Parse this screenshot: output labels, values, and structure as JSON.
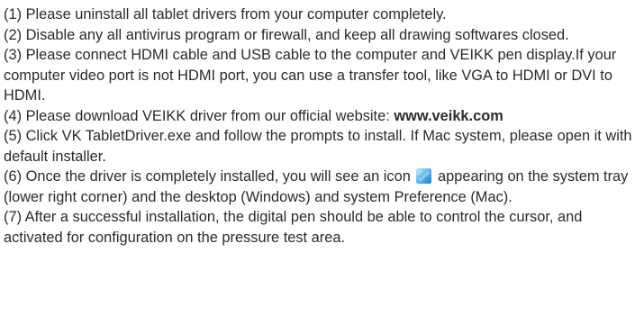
{
  "steps": [
    {
      "text": "(1) Please uninstall all tablet drivers from your computer completely."
    },
    {
      "text": "(2) Disable any all antivirus program or firewall, and keep all drawing softwares closed."
    },
    {
      "text": "(3) Please connect HDMI cable and USB cable to the computer and VEIKK pen display.If your computer video port is not HDMI port, you can use a transfer tool, like VGA to HDMI or DVI to HDMI."
    },
    {
      "text": "(4) Please download VEIKK driver from our official website: ",
      "link": "www.veikk.com"
    },
    {
      "text": "(5) Click VK TabletDriver.exe and follow the prompts to install. If Mac system, please open it with default installer."
    },
    {
      "before": "(6) Once the driver is completely installed, you will see an icon",
      "icon": "veikk-driver-tray-icon",
      "after": " appearing on the system tray (lower right corner) and the desktop (Windows) and system Preference (Mac)."
    },
    {
      "text": "(7) After a successful installation, the digital pen should be able to control the cursor, and activated for configuration on the pressure test area."
    }
  ],
  "colors": {
    "text": "#2b2b2b",
    "icon_light": "#8fd3f7",
    "icon_dark": "#1f7fcf"
  }
}
